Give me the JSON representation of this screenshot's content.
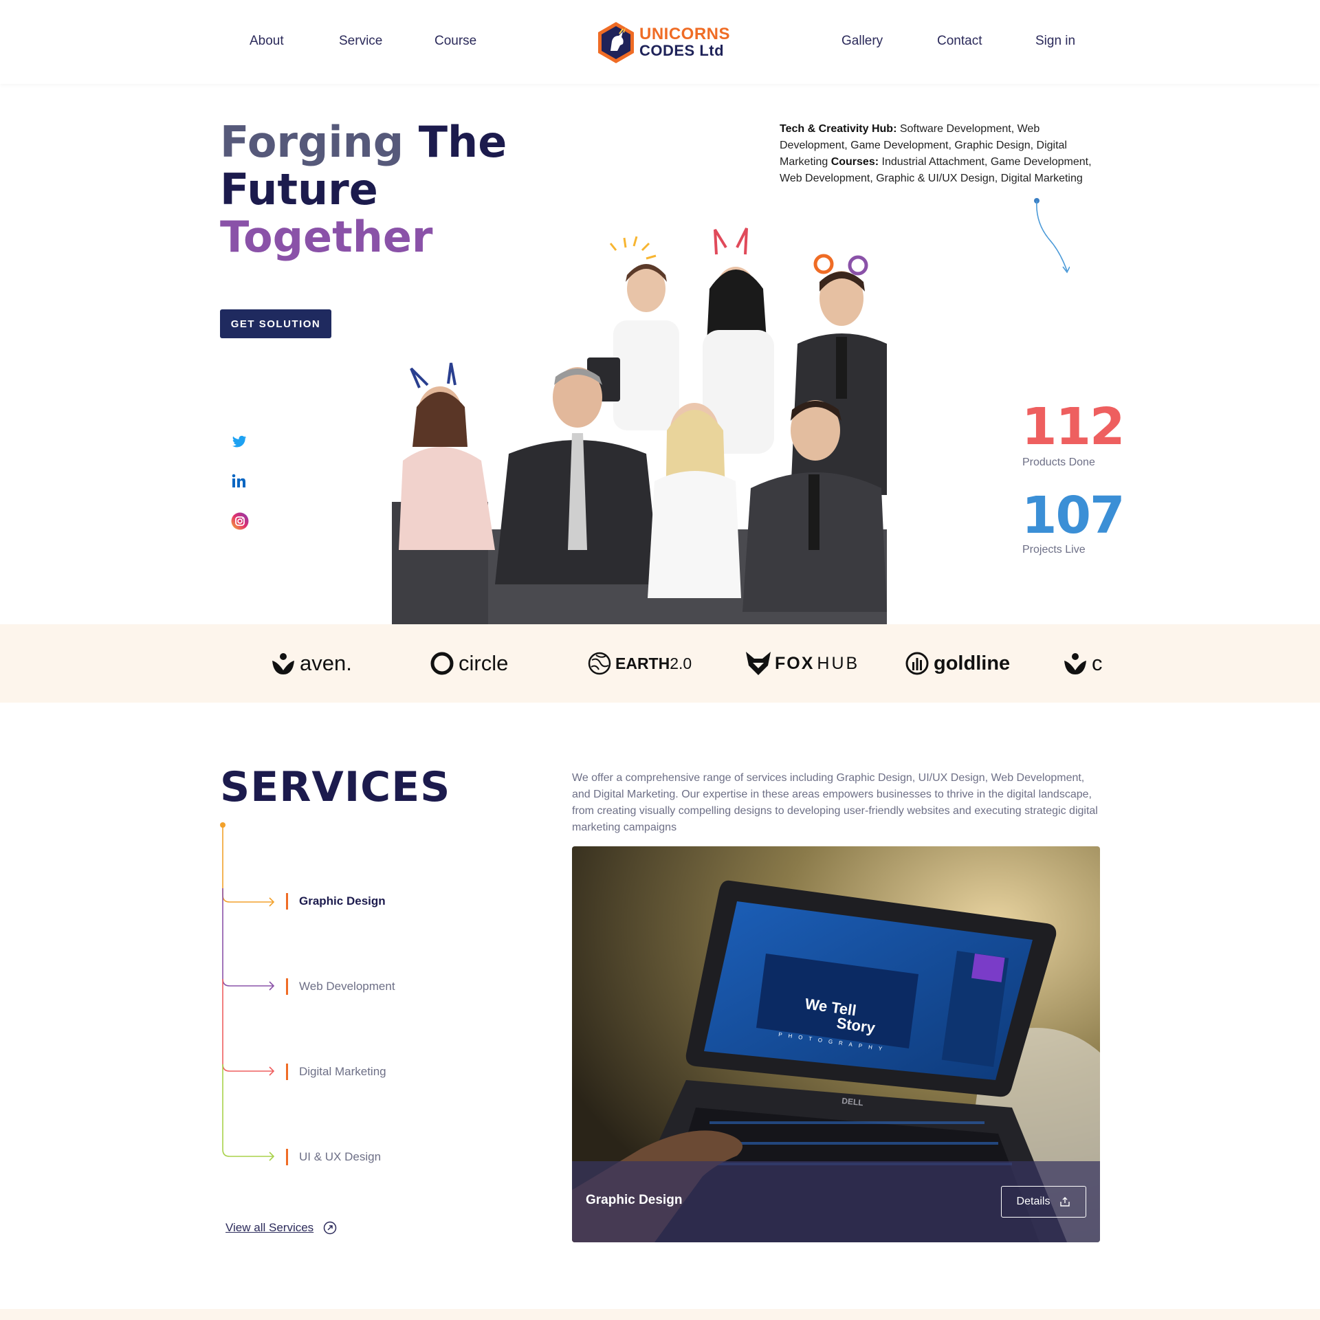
{
  "nav": {
    "left": [
      "About",
      "Service",
      "Course"
    ],
    "right": [
      "Gallery",
      "Contact",
      "Sign in"
    ],
    "logo_line1": "UNICORNS",
    "logo_line2": "CODES Ltd"
  },
  "hero": {
    "title_part1": "Forging",
    "title_part2": "The",
    "title_part3": "Future",
    "title_part4": "Together",
    "cta": "GET SOLUTION",
    "hub_label": "Tech & Creativity Hub:",
    "hub_text": " Software Development, Web Development, Game Development, Graphic Design, Digital Marketing ",
    "courses_label": "Courses:",
    "courses_text": " Industrial Attachment, Game Development, Web Development, Graphic & UI/UX Design, Digital Marketing"
  },
  "social_icons": [
    "twitter-icon",
    "linkedin-icon",
    "instagram-icon"
  ],
  "stats": [
    {
      "value": "112",
      "label": "Products Done",
      "color": "#ee5f5f"
    },
    {
      "value": "107",
      "label": "Projects Live",
      "color": "#3b8fd6"
    }
  ],
  "brands": [
    "aven.",
    "circle",
    "EARTH",
    "2.0",
    "FOX",
    "HUB",
    "goldline",
    "c"
  ],
  "services": {
    "title": "SERVICES",
    "description": "We offer a comprehensive range of services including Graphic Design, UI/UX Design, Web Development, and Digital Marketing. Our expertise in these areas empowers businesses to thrive in the digital landscape, from creating visually compelling designs to developing user-friendly websites and executing strategic digital marketing campaigns",
    "items": [
      "Graphic Design",
      "Web Development",
      "Digital Marketing",
      "UI & UX Design"
    ],
    "active_index": 0,
    "view_all": "View all Services",
    "card_title": "Graphic Design",
    "card_button": "Details",
    "screen_text1": "We Tell",
    "screen_text2": "Story",
    "screen_text3": "PHOTOGRAPHY",
    "laptop_brand": "DELL"
  },
  "colors": {
    "primary": "#1c1b4d",
    "accent": "#ef6c25",
    "purple": "#8a52a8",
    "strip_bg": "#fdf5ec"
  }
}
